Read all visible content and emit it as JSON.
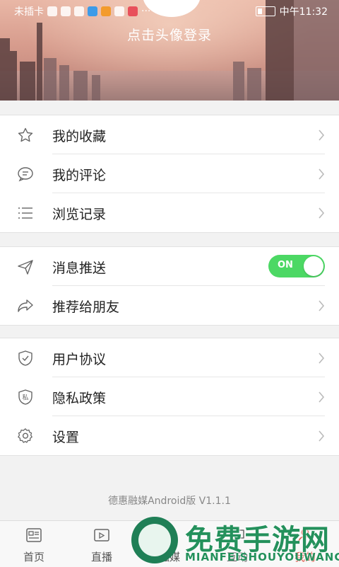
{
  "status_bar": {
    "carrier": "未插卡",
    "extra": "···",
    "time": "中午11:32"
  },
  "header": {
    "login_prompt": "点击头像登录"
  },
  "group1": [
    {
      "label": "我的收藏",
      "icon": "star-icon"
    },
    {
      "label": "我的评论",
      "icon": "comment-icon"
    },
    {
      "label": "浏览记录",
      "icon": "list-icon"
    }
  ],
  "group2": {
    "push": {
      "label": "消息推送",
      "icon": "send-icon",
      "toggle_label": "ON",
      "toggle_on": true
    },
    "share": {
      "label": "推荐给朋友",
      "icon": "share-icon"
    }
  },
  "group3": [
    {
      "label": "用户协议",
      "icon": "shield-check-icon"
    },
    {
      "label": "隐私政策",
      "icon": "privacy-shield-icon",
      "icon_text": "私"
    },
    {
      "label": "设置",
      "icon": "gear-icon"
    }
  ],
  "version": "德惠融媒Android版 V1.1.1",
  "bottom_nav": [
    {
      "label": "首页",
      "icon": "news-icon"
    },
    {
      "label": "直播",
      "icon": "video-icon"
    },
    {
      "label": "融媒",
      "icon": "media-icon"
    },
    {
      "label": "互动",
      "icon": "chat-icon"
    },
    {
      "label": "我的",
      "icon": "profile-icon",
      "active": true
    }
  ],
  "watermark": {
    "title": "免费手游网",
    "subtitle": "MIANFEISHOUYOUWANG"
  },
  "colors": {
    "accent_green": "#4cd864",
    "active_tab": "#e14b3b",
    "watermark_green": "#24915c"
  }
}
